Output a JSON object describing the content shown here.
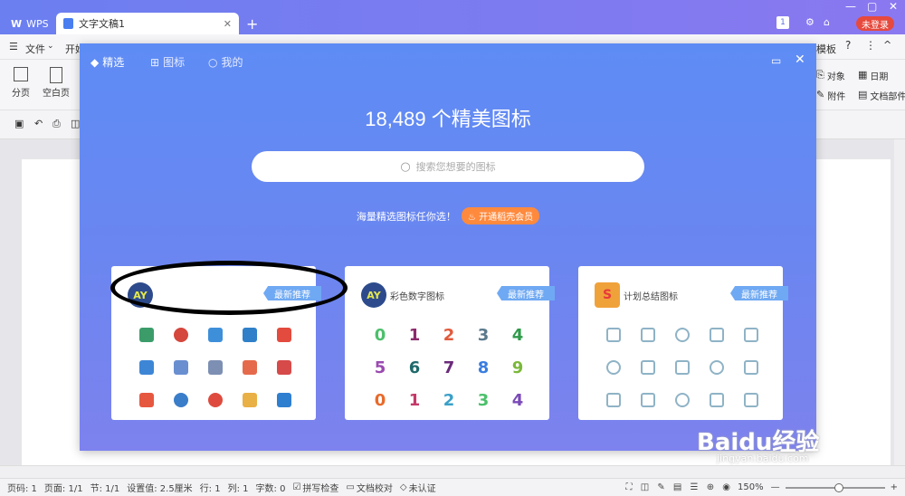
{
  "titlebar": {
    "wps_tab": "WPS",
    "doc_tab": "文字文稿1",
    "add_tab": "+",
    "page_badge": "1",
    "login": "未登录"
  },
  "menubar": {
    "file": "文件",
    "start_partial": "开始",
    "right_item": "模板"
  },
  "ribbon": {
    "left": [
      {
        "label": "分页"
      },
      {
        "label": "空白页"
      }
    ],
    "right": [
      {
        "label": "对象"
      },
      {
        "label": "日期"
      },
      {
        "label": "附件"
      },
      {
        "label": "文档部件"
      }
    ]
  },
  "dialog": {
    "tabs": [
      {
        "label": "精选"
      },
      {
        "label": "图标"
      },
      {
        "label": "我的"
      }
    ],
    "headline": "18,489 个精美图标",
    "search_placeholder": "搜索您想要的图标",
    "promo_text": "海量精选图标任你选！",
    "promo_button": "开通稻壳会员",
    "cards": [
      {
        "title": "",
        "badge": "最新推荐",
        "logo_text": "AY",
        "logo_color": "#2d4b8c"
      },
      {
        "title": "彩色数字图标",
        "badge": "最新推荐",
        "logo_text": "AY",
        "logo_color": "#2d4b8c",
        "digits": [
          "0",
          "1",
          "2",
          "3",
          "4",
          "5",
          "6",
          "7",
          "8",
          "9",
          "0",
          "1",
          "2",
          "3",
          "4"
        ]
      },
      {
        "title": "计划总结图标",
        "badge": "最新推荐",
        "logo_text": "S",
        "logo_color": "#f0a23a"
      }
    ]
  },
  "statusbar": {
    "page_code": "页码: 1",
    "pages": "页面: 1/1",
    "section": "节: 1/1",
    "setting": "设置值: 2.5厘米",
    "row": "行: 1",
    "col": "列: 1",
    "words": "字数: 0",
    "spell": "拼写检查",
    "proof": "文档校对",
    "auth": "未认证",
    "zoom": "150%"
  },
  "watermark": {
    "brand": "Baidu经验",
    "url": "jingyan.baidu.com"
  }
}
